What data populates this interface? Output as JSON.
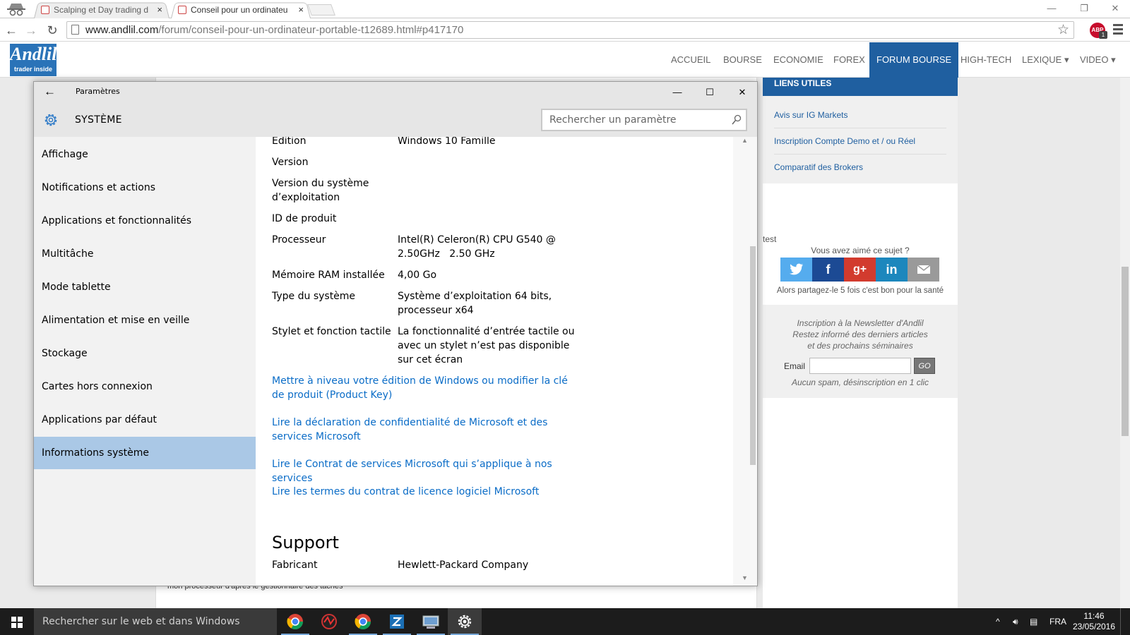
{
  "browser": {
    "tabs": [
      {
        "title": "Scalping et Day trading d",
        "active": false
      },
      {
        "title": "Conseil pour un ordinateu",
        "active": true
      }
    ],
    "close_glyph": "×",
    "url_domain": "www.andlil.com",
    "url_path": "/forum/conseil-pour-un-ordinateur-portable-t12689.html#p417170",
    "abp_label": "ABP",
    "abp_badge": "1"
  },
  "website": {
    "logo_main": "Andlil",
    "logo_sub": "trader inside",
    "nav": [
      {
        "label": "ACCUEIL",
        "active": false
      },
      {
        "label": "BOURSE",
        "active": false
      },
      {
        "label": "ECONOMIE",
        "active": false
      },
      {
        "label": "FOREX",
        "active": false
      },
      {
        "label": "FORUM BOURSE",
        "active": true
      },
      {
        "label": "HIGH-TECH",
        "active": false
      },
      {
        "label": "LEXIQUE ▾",
        "active": false
      },
      {
        "label": "VIDEO ▾",
        "active": false
      }
    ],
    "post_text": "mon processeur d'après le gestionnaire des taches",
    "sidebar": {
      "links_title": "LIENS UTILES",
      "links": [
        "Avis sur IG Markets",
        "Inscription Compte Demo et / ou Réel",
        "Comparatif des Brokers"
      ],
      "test": "test",
      "share_question": "Vous avez aimé ce sujet ?",
      "share_note": "Alors partagez-le 5 fois c'est bon pour la santé",
      "newsletter": {
        "line1": "Inscription à la Newsletter d'Andlil",
        "line2": "Restez informé des derniers articles",
        "line3": "et des prochains séminaires",
        "email_label": "Email",
        "go": "GO",
        "note": "Aucun spam, désinscription en 1 clic"
      }
    }
  },
  "settings": {
    "title": "Paramètres",
    "section": "SYSTÈME",
    "search_placeholder": "Rechercher un paramètre",
    "nav": [
      "Affichage",
      "Notifications et actions",
      "Applications et fonctionnalités",
      "Multitâche",
      "Mode tablette",
      "Alimentation et mise en veille",
      "Stockage",
      "Cartes hors connexion",
      "Applications par défaut",
      "Informations système"
    ],
    "selected_nav": "Informations système",
    "rows": [
      {
        "label": "Edition",
        "value": "Windows 10 Famille"
      },
      {
        "label": "Version",
        "value": ""
      },
      {
        "label": "Version du système d’exploitation",
        "value": ""
      },
      {
        "label": "ID de produit",
        "value": ""
      },
      {
        "label": "Processeur",
        "value": "Intel(R) Celeron(R) CPU G540 @ 2.50GHz   2.50 GHz"
      },
      {
        "label": "Mémoire RAM installée",
        "value": "4,00 Go"
      },
      {
        "label": "Type du système",
        "value": "Système d’exploitation 64 bits, processeur x64"
      },
      {
        "label": "Stylet et fonction tactile",
        "value": "La fonctionnalité d’entrée tactile ou avec un stylet n’est pas disponible sur cet écran"
      }
    ],
    "links": [
      "Mettre à niveau votre édition de Windows ou modifier la clé de produit (Product Key)",
      "Lire la déclaration de confidentialité de Microsoft et des services Microsoft",
      "Lire le Contrat de services Microsoft qui s’applique à nos services",
      "Lire les termes du contrat de licence logiciel Microsoft"
    ],
    "support_title": "Support",
    "support_rows": [
      {
        "label": "Fabricant",
        "value": "Hewlett-Packard Company"
      }
    ]
  },
  "taskbar": {
    "search_placeholder": "Rechercher sur le web et dans Windows",
    "language": "FRA",
    "time": "11:46",
    "date": "23/05/2016"
  }
}
